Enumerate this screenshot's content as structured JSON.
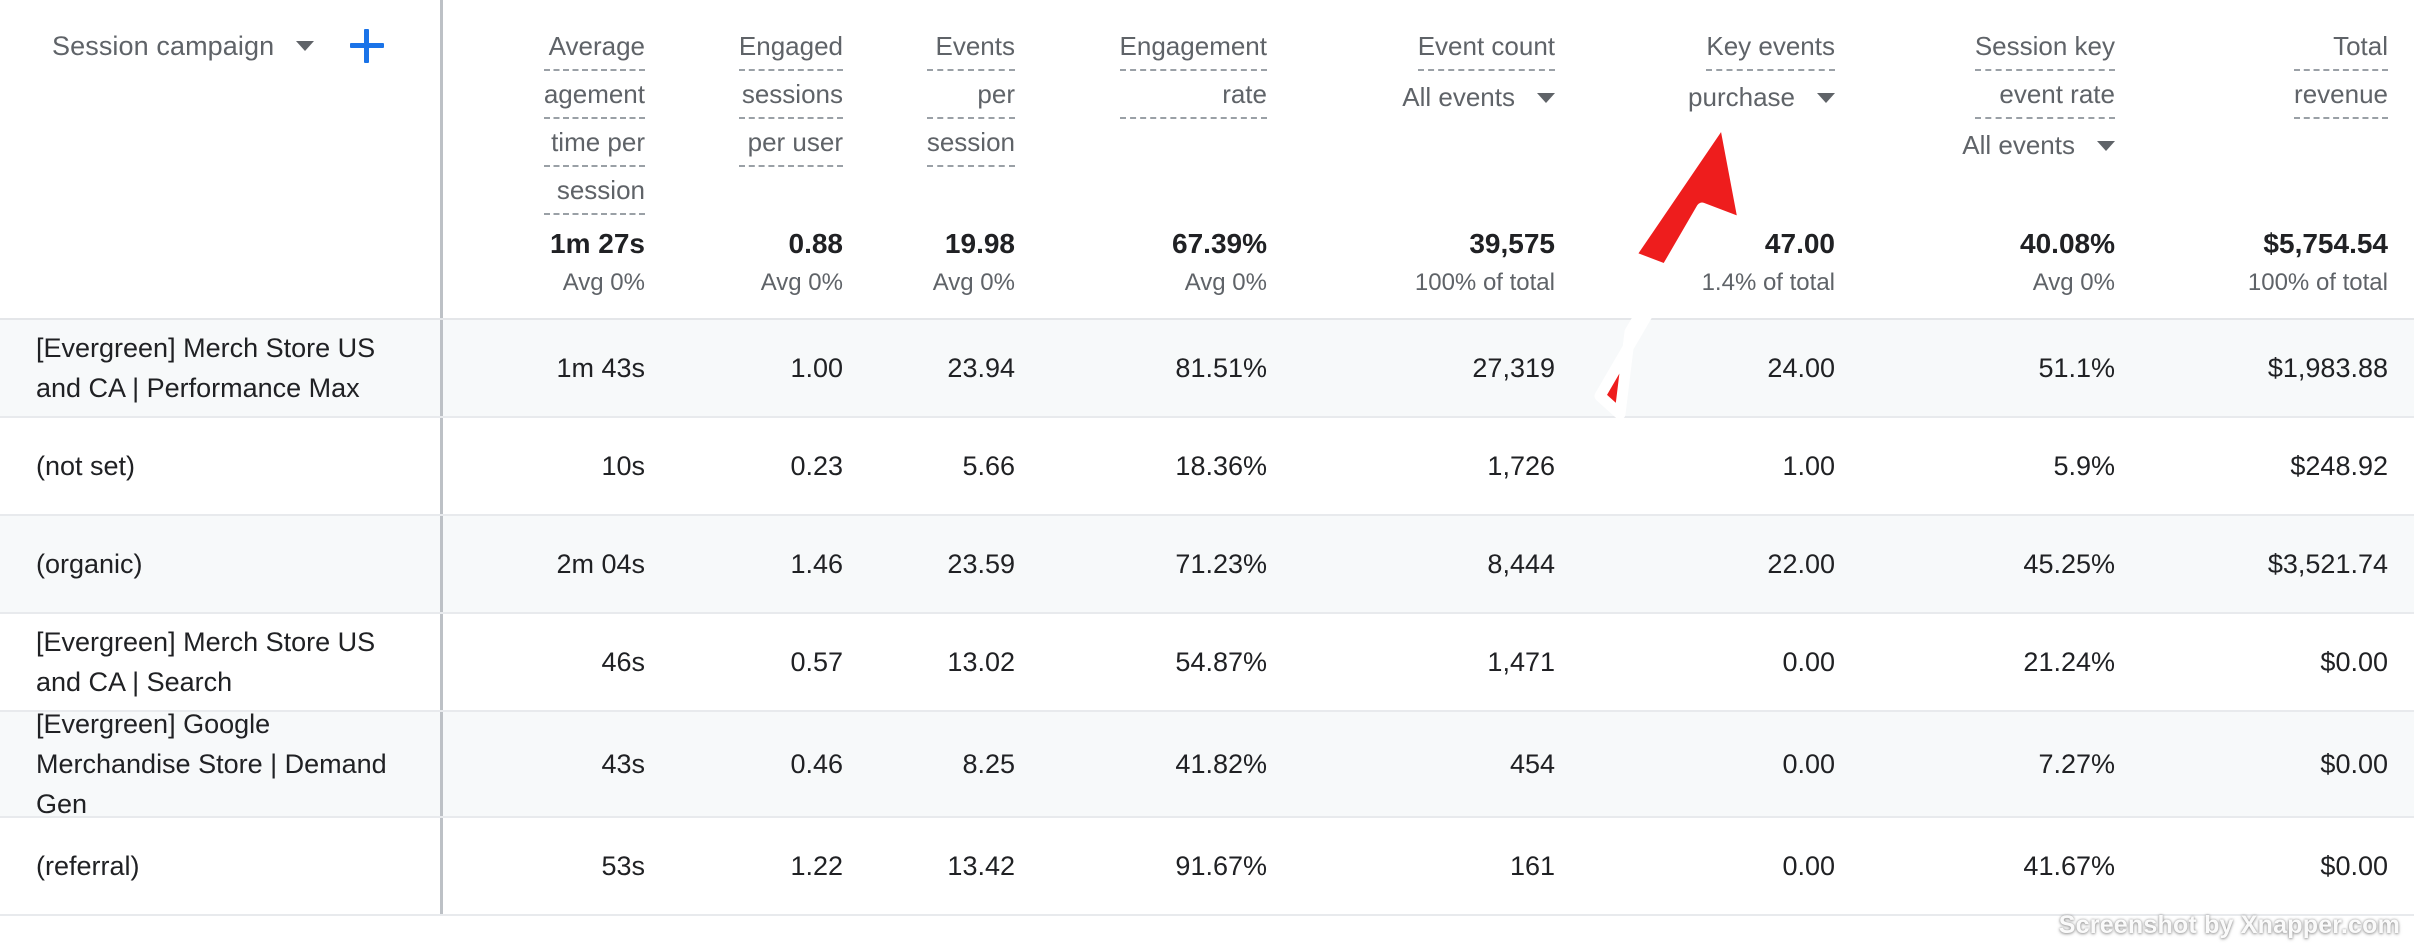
{
  "dimension": {
    "label": "Session campaign",
    "caret_icon": "chevron-down-icon",
    "add_icon": "plus-icon"
  },
  "colors": {
    "accent_blue": "#1a73e8",
    "text_primary": "#202124",
    "text_secondary": "#5f6368",
    "row_alt": "#f7f9fa",
    "annotation_red": "#ee1d1d"
  },
  "columns": [
    {
      "key": "avg_engagement_time",
      "title_lines": [
        "Average",
        "agement",
        "time per",
        "session"
      ],
      "full_title": "Average engagement time per session",
      "selector": null
    },
    {
      "key": "engaged_sessions_per_user",
      "title_lines": [
        "Engaged",
        "sessions",
        "per user"
      ],
      "full_title": "Engaged sessions per user",
      "selector": null
    },
    {
      "key": "events_per_session",
      "title_lines": [
        "Events",
        "per",
        "session"
      ],
      "full_title": "Events per session",
      "selector": null
    },
    {
      "key": "engagement_rate",
      "title_lines": [
        "Engagement",
        "rate"
      ],
      "full_title": "Engagement rate",
      "selector": null
    },
    {
      "key": "event_count",
      "title_lines": [
        "Event count"
      ],
      "full_title": "Event count",
      "selector": "All events"
    },
    {
      "key": "key_events",
      "title_lines": [
        "Key events"
      ],
      "full_title": "Key events",
      "selector": "purchase"
    },
    {
      "key": "session_key_event_rate",
      "title_lines": [
        "Session key",
        "event rate"
      ],
      "full_title": "Session key event rate",
      "selector": "All events"
    },
    {
      "key": "total_revenue",
      "title_lines": [
        "Total",
        "revenue"
      ],
      "full_title": "Total revenue",
      "selector": null
    }
  ],
  "summary": {
    "values": [
      "1m 27s",
      "0.88",
      "19.98",
      "67.39%",
      "39,575",
      "47.00",
      "40.08%",
      "$5,754.54"
    ],
    "subtexts": [
      "Avg 0%",
      "Avg 0%",
      "Avg 0%",
      "Avg 0%",
      "100% of total",
      "1.4% of total",
      "Avg 0%",
      "100% of total"
    ]
  },
  "rows": [
    {
      "dimension": "[Evergreen] Merch Store US and CA | Performance Max",
      "values": [
        "1m 43s",
        "1.00",
        "23.94",
        "81.51%",
        "27,319",
        "24.00",
        "51.1%",
        "$1,983.88"
      ]
    },
    {
      "dimension": "(not set)",
      "values": [
        "10s",
        "0.23",
        "5.66",
        "18.36%",
        "1,726",
        "1.00",
        "5.9%",
        "$248.92"
      ]
    },
    {
      "dimension": "(organic)",
      "values": [
        "2m 04s",
        "1.46",
        "23.59",
        "71.23%",
        "8,444",
        "22.00",
        "45.25%",
        "$3,521.74"
      ]
    },
    {
      "dimension": "[Evergreen] Merch Store US and CA | Search",
      "values": [
        "46s",
        "0.57",
        "13.02",
        "54.87%",
        "1,471",
        "0.00",
        "21.24%",
        "$0.00"
      ]
    },
    {
      "dimension": "[Evergreen] Google Merchandise Store | Demand Gen",
      "values": [
        "43s",
        "0.46",
        "8.25",
        "41.82%",
        "454",
        "0.00",
        "7.27%",
        "$0.00"
      ]
    },
    {
      "dimension": "(referral)",
      "values": [
        "53s",
        "1.22",
        "13.42",
        "91.67%",
        "161",
        "0.00",
        "41.67%",
        "$0.00"
      ]
    }
  ],
  "annotation": {
    "type": "arrow",
    "direction": "up-right",
    "points_at": "Key events purchase column header"
  },
  "watermark": "Screenshot by Xnapper.com"
}
